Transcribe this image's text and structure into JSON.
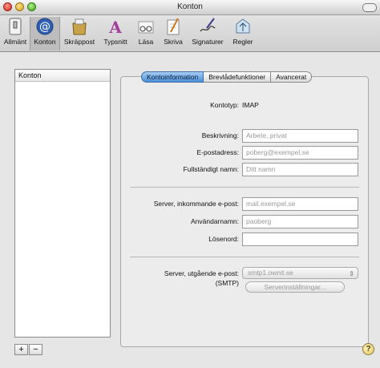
{
  "window": {
    "title": "Konton"
  },
  "toolbar": {
    "items": [
      {
        "label": "Allmänt",
        "icon": "switch-icon"
      },
      {
        "label": "Konton",
        "icon": "at-sign-icon",
        "selected": true
      },
      {
        "label": "Skräppost",
        "icon": "junk-mail-bag-icon"
      },
      {
        "label": "Typsnitt",
        "icon": "fonts-icon"
      },
      {
        "label": "Läsa",
        "icon": "glasses-icon"
      },
      {
        "label": "Skriva",
        "icon": "pencil-pad-icon"
      },
      {
        "label": "Signaturer",
        "icon": "signature-pen-icon"
      },
      {
        "label": "Regler",
        "icon": "rules-icon"
      }
    ]
  },
  "accounts": {
    "header": "Konton",
    "add": "+",
    "remove": "−"
  },
  "tabs": [
    {
      "label": "Kontoinformation",
      "active": true
    },
    {
      "label": "Brevlådefunktioner"
    },
    {
      "label": "Avancerat"
    }
  ],
  "form": {
    "account_type_label": "Kontotyp:",
    "account_type_value": "IMAP",
    "description_label": "Beskrivning:",
    "description_placeholder": "Arbete, privat",
    "email_label": "E-postadress:",
    "email_placeholder": "poberg@exempel.se",
    "fullname_label": "Fullständigt namn:",
    "fullname_placeholder": "Ditt namn",
    "incoming_label": "Server, inkommande e-post:",
    "incoming_placeholder": "mail.exempel.se",
    "username_label": "Användarnamn:",
    "username_placeholder": "paoberg",
    "password_label": "Lösenord:",
    "outgoing_label": "Server, utgående e-post:",
    "outgoing_sub_label": "(SMTP)",
    "outgoing_value": "smtp1.ownit.se",
    "server_settings_button": "Serverinställningar..."
  },
  "help": "?"
}
